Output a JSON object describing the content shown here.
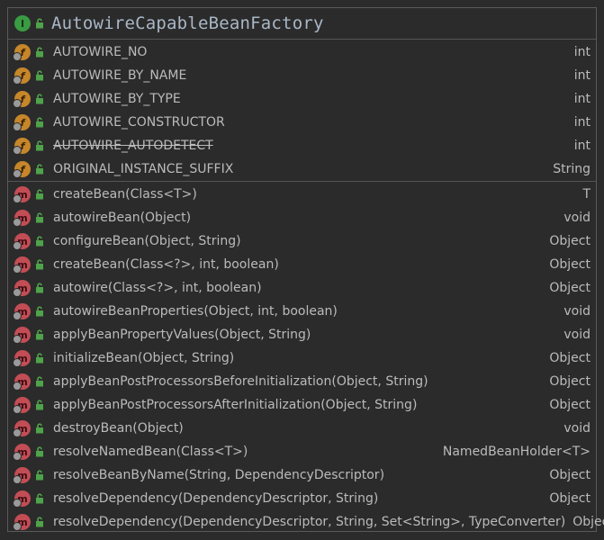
{
  "class_name": "AutowireCapableBeanFactory",
  "class_kind_icon": "interface-icon",
  "fields": [
    {
      "name": "AUTOWIRE_NO",
      "type": "int",
      "deprecated": false
    },
    {
      "name": "AUTOWIRE_BY_NAME",
      "type": "int",
      "deprecated": false
    },
    {
      "name": "AUTOWIRE_BY_TYPE",
      "type": "int",
      "deprecated": false
    },
    {
      "name": "AUTOWIRE_CONSTRUCTOR",
      "type": "int",
      "deprecated": false
    },
    {
      "name": "AUTOWIRE_AUTODETECT",
      "type": "int",
      "deprecated": true
    },
    {
      "name": "ORIGINAL_INSTANCE_SUFFIX",
      "type": "String",
      "deprecated": false
    }
  ],
  "methods": [
    {
      "name": "createBean(Class<T>)",
      "type": "T"
    },
    {
      "name": "autowireBean(Object)",
      "type": "void"
    },
    {
      "name": "configureBean(Object, String)",
      "type": "Object"
    },
    {
      "name": "createBean(Class<?>, int, boolean)",
      "type": "Object"
    },
    {
      "name": "autowire(Class<?>, int, boolean)",
      "type": "Object"
    },
    {
      "name": "autowireBeanProperties(Object, int, boolean)",
      "type": "void"
    },
    {
      "name": "applyBeanPropertyValues(Object, String)",
      "type": "void"
    },
    {
      "name": "initializeBean(Object, String)",
      "type": "Object"
    },
    {
      "name": "applyBeanPostProcessorsBeforeInitialization(Object, String)",
      "type": "Object"
    },
    {
      "name": "applyBeanPostProcessorsAfterInitialization(Object, String)",
      "type": "Object"
    },
    {
      "name": "destroyBean(Object)",
      "type": "void"
    },
    {
      "name": "resolveNamedBean(Class<T>)",
      "type": "NamedBeanHolder<T>"
    },
    {
      "name": "resolveBeanByName(String, DependencyDescriptor)",
      "type": "Object"
    },
    {
      "name": "resolveDependency(DependencyDescriptor, String)",
      "type": "Object"
    },
    {
      "name": "resolveDependency(DependencyDescriptor, String, Set<String>, TypeConverter)",
      "type": "Object"
    }
  ],
  "icon_letters": {
    "interface": "I",
    "field": "f",
    "method": "m"
  },
  "colors": {
    "interface_badge": "#3a9b42",
    "field_badge": "#c6862a",
    "method_badge": "#c24d55",
    "public_lock": "#4fa34a"
  }
}
